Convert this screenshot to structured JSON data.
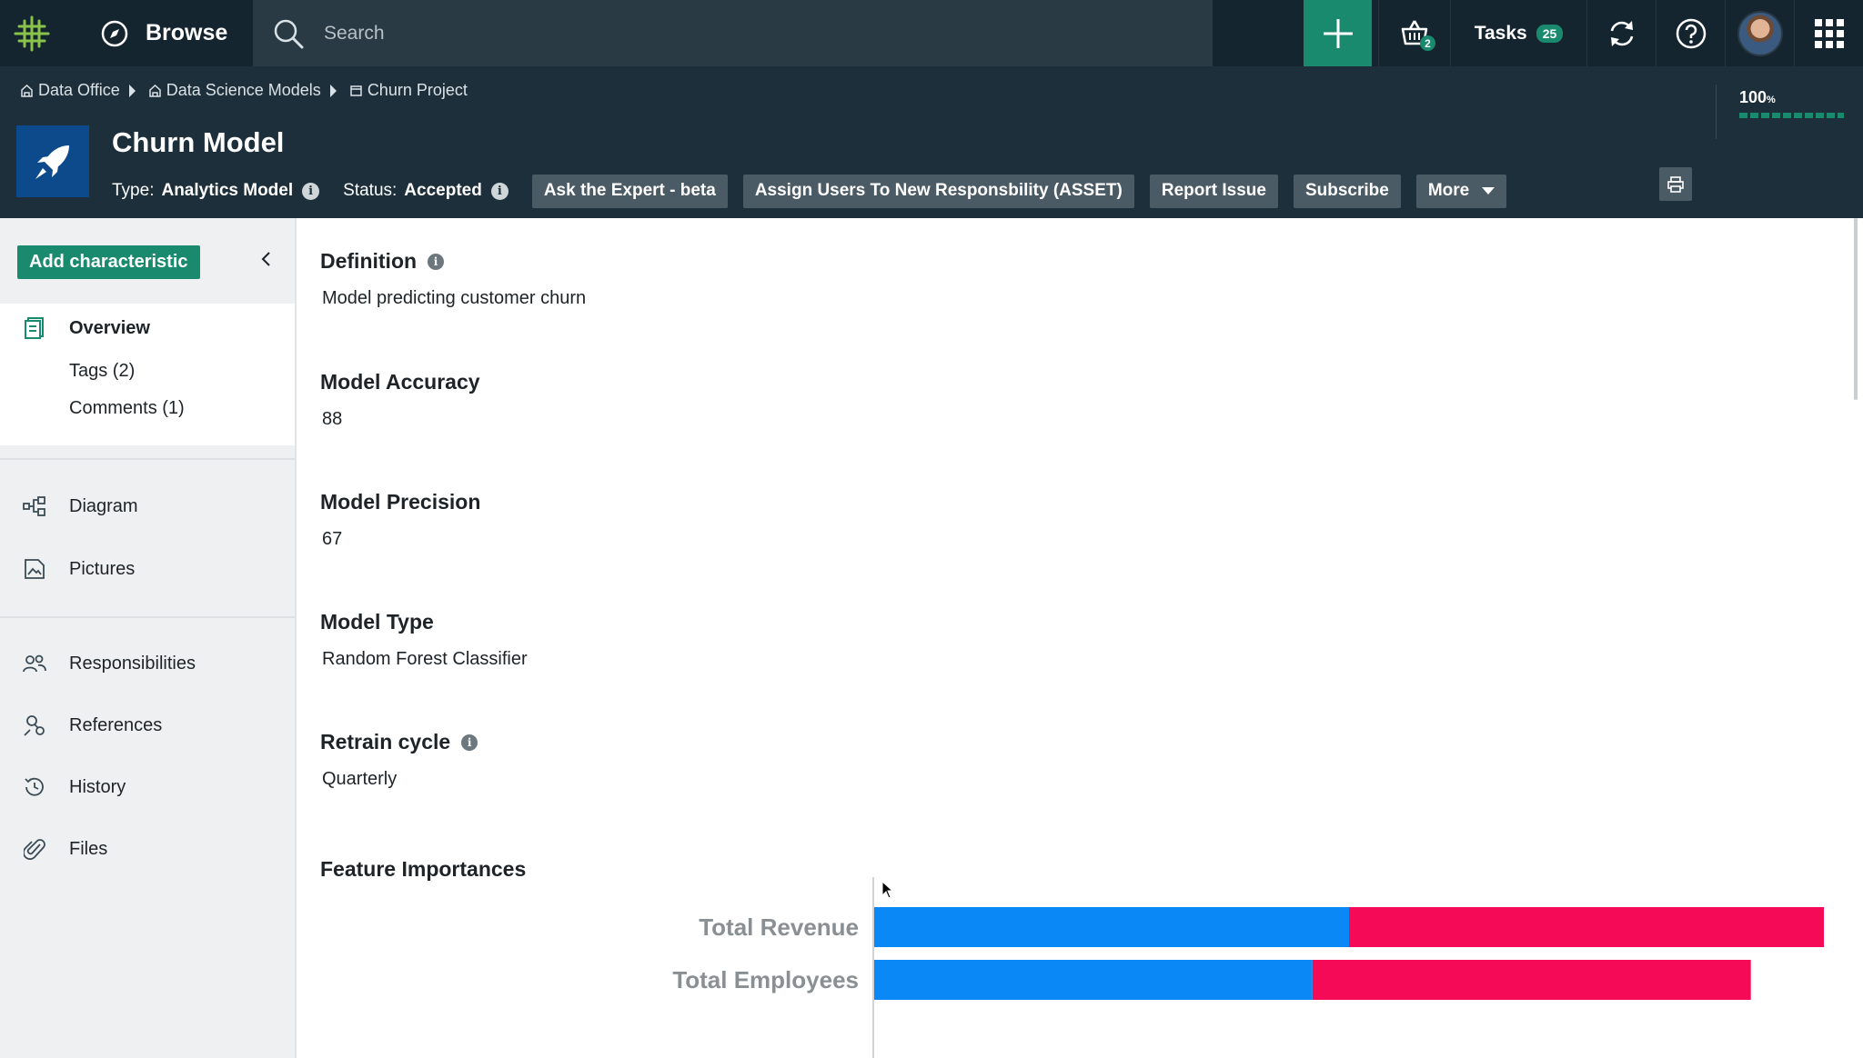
{
  "topbar": {
    "browse_label": "Browse",
    "search_placeholder": "Search",
    "basket_count": "2",
    "tasks_label": "Tasks",
    "tasks_count": "25",
    "icons": [
      "logo-icon",
      "compass-icon",
      "search-icon",
      "plus-icon",
      "basket-icon",
      "sync-icon",
      "help-icon",
      "avatar",
      "apps-grid-icon"
    ]
  },
  "breadcrumb": [
    {
      "label": "Data Office",
      "icon": "community-icon"
    },
    {
      "label": "Data Science Models",
      "icon": "community-icon"
    },
    {
      "label": "Churn Project",
      "icon": "domain-icon"
    }
  ],
  "asset": {
    "title": "Churn Model",
    "type_label": "Type:",
    "type_value": "Analytics Model",
    "status_label": "Status:",
    "status_value": "Accepted",
    "completeness": "100",
    "completeness_unit": "%",
    "completeness_fraction": 1.0
  },
  "actions": {
    "ask_expert": "Ask the Expert - beta",
    "assign_users": "Assign Users To New Responsbility (ASSET)",
    "report_issue": "Report Issue",
    "subscribe": "Subscribe",
    "more": "More"
  },
  "sidebar": {
    "add_characteristic": "Add characteristic",
    "overview": "Overview",
    "tags": "Tags (2)",
    "comments": "Comments (1)",
    "diagram": "Diagram",
    "pictures": "Pictures",
    "responsibilities": "Responsibilities",
    "references": "References",
    "history": "History",
    "files": "Files"
  },
  "fields": {
    "definition": {
      "label": "Definition",
      "value": "Model predicting customer churn"
    },
    "accuracy": {
      "label": "Model Accuracy",
      "value": "88"
    },
    "precision": {
      "label": "Model Precision",
      "value": "67"
    },
    "model_type": {
      "label": "Model Type",
      "value": "Random Forest Classifier"
    },
    "retrain": {
      "label": "Retrain cycle",
      "value": "Quarterly"
    },
    "feature_importances": {
      "label": "Feature Importances"
    }
  },
  "colors": {
    "accent": "#1a8a6e",
    "topbar_bg": "#142530",
    "header_bg": "#1d2f3a",
    "series_blue": "#0a88f5",
    "series_red": "#f50a57"
  },
  "chart_data": {
    "type": "bar",
    "orientation": "horizontal",
    "stacked": true,
    "categories": [
      "Total Revenue",
      "Total Employees"
    ],
    "series": [
      {
        "values": [
          0.52,
          0.48
        ]
      },
      {
        "values": [
          0.52,
          0.48
        ]
      }
    ]
  }
}
